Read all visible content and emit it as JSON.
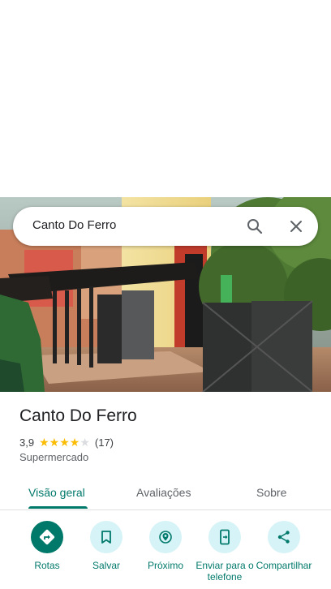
{
  "search": {
    "query": "Canto Do Ferro",
    "icons": [
      "search-icon",
      "close-icon"
    ]
  },
  "place": {
    "name": "Canto Do Ferro",
    "rating": "3,9",
    "rating_value": 3.9,
    "stars_filled": 4,
    "stars_total": 5,
    "review_count": "(17)",
    "category": "Supermercado"
  },
  "tabs": [
    {
      "label": "Visão geral",
      "active": true
    },
    {
      "label": "Avaliações",
      "active": false
    },
    {
      "label": "Sobre",
      "active": false
    }
  ],
  "actions": [
    {
      "label": "Rotas",
      "icon": "directions-icon"
    },
    {
      "label": "Salvar",
      "icon": "bookmark-icon"
    },
    {
      "label": "Próximo",
      "icon": "nearby-icon"
    },
    {
      "label": "Enviar para o telefone",
      "icon": "send-to-phone-icon"
    },
    {
      "label": "Compartilhar",
      "icon": "share-icon"
    }
  ],
  "colors": {
    "accent": "#00796b",
    "action_bg": "#d6f3f7",
    "star": "#fbbc04"
  }
}
